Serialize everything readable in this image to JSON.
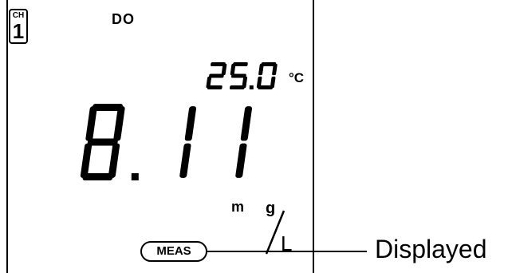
{
  "display": {
    "channel_label": "CH",
    "channel_number": "1",
    "mode": "DO",
    "temperature": "25.0",
    "temperature_unit": "°C",
    "reading": "8.11",
    "unit_m": "m",
    "unit_g": "g",
    "unit_L": "L",
    "status": "MEAS"
  },
  "callout": {
    "text": "Displayed"
  },
  "icons": [
    "lcd-seven-segment-digits",
    "meas-indicator"
  ],
  "colors": {
    "ink": "#000000",
    "background": "#ffffff"
  }
}
